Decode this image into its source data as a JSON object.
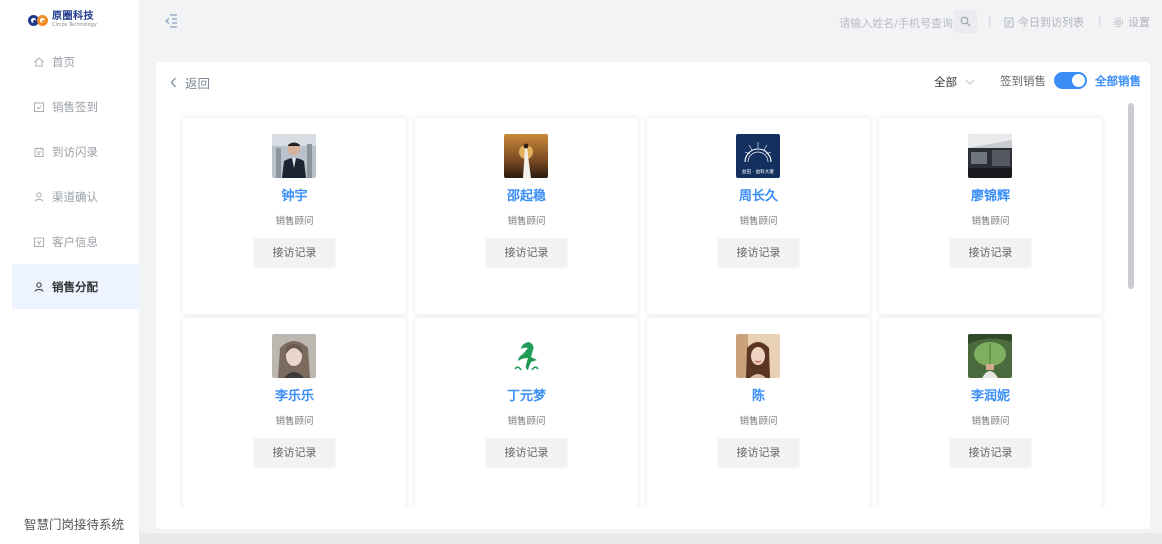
{
  "brand": {
    "name_cn": "原圈科技",
    "name_en": "Circos Technology"
  },
  "sidebar": {
    "items": [
      {
        "label": "首页",
        "icon": "home-icon",
        "active": false
      },
      {
        "label": "销售签到",
        "icon": "checkin-icon",
        "active": false
      },
      {
        "label": "到访闪录",
        "icon": "visit-record-icon",
        "active": false
      },
      {
        "label": "渠道确认",
        "icon": "channel-icon",
        "active": false
      },
      {
        "label": "客户信息",
        "icon": "customer-info-icon",
        "active": false
      },
      {
        "label": "销售分配",
        "icon": "assign-icon",
        "active": true
      }
    ],
    "system_name": "智慧门岗接待系统"
  },
  "header": {
    "search_placeholder": "请输入姓名/手机号查询",
    "separator": "|",
    "today_visits_label": "今日到访列表",
    "settings_label": "设置"
  },
  "panel": {
    "back_label": "返回",
    "filter_value": "全部",
    "toggle_left_label": "签到销售",
    "toggle_right_label": "全部销售",
    "toggle_on": true
  },
  "cards": [
    {
      "name": "钟宇",
      "role": "销售顾问",
      "button": "接访记录",
      "avatar": "photo-suit"
    },
    {
      "name": "邵起稳",
      "role": "销售顾问",
      "button": "接访记录",
      "avatar": "photo-sunset"
    },
    {
      "name": "周长久",
      "role": "销售顾问",
      "button": "接访记录",
      "avatar": "logo-tower",
      "avatar_caption": "益田 · 益科大厦"
    },
    {
      "name": "廖锦辉",
      "role": "销售顾问",
      "button": "接访记录",
      "avatar": "photo-car"
    },
    {
      "name": "李乐乐",
      "role": "销售顾问",
      "button": "接访记录",
      "avatar": "photo-woman"
    },
    {
      "name": "丁元梦",
      "role": "销售顾问",
      "button": "接访记录",
      "avatar": "logo-green"
    },
    {
      "name": "陈",
      "role": "销售顾问",
      "button": "接访记录",
      "avatar": "photo-girl"
    },
    {
      "name": "李润妮",
      "role": "销售顾问",
      "button": "接访记录",
      "avatar": "photo-leaf"
    }
  ],
  "colors": {
    "accent": "#3a8ef6",
    "brand_blue": "#1f3a8a",
    "brand_orange": "#f08a24"
  }
}
